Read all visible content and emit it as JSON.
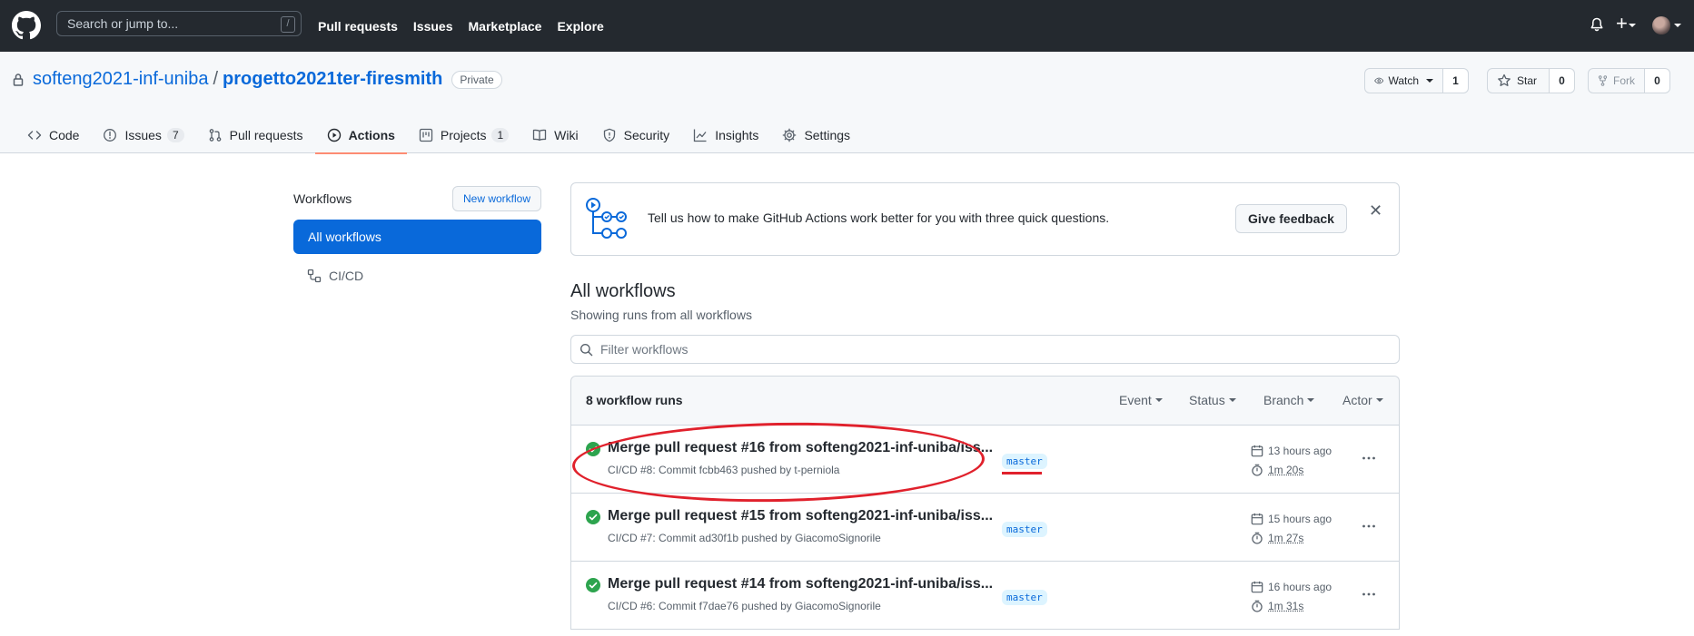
{
  "header": {
    "search_placeholder": "Search or jump to...",
    "search_shortcut": "/",
    "nav": [
      "Pull requests",
      "Issues",
      "Marketplace",
      "Explore"
    ],
    "icons": [
      "github-logo-icon",
      "bell-icon",
      "plus-icon",
      "avatar"
    ]
  },
  "repo": {
    "owner": "softeng2021-inf-uniba",
    "separator": "/",
    "name": "progetto2021ter-firesmith",
    "visibility": "Private",
    "watch_label": "Watch",
    "watch_count": "1",
    "star_label": "Star",
    "star_count": "0",
    "fork_label": "Fork",
    "fork_count": "0"
  },
  "tabs": [
    {
      "label": "Code",
      "icon": "code-icon"
    },
    {
      "label": "Issues",
      "counter": "7",
      "icon": "issue-icon"
    },
    {
      "label": "Pull requests",
      "icon": "pull-request-icon"
    },
    {
      "label": "Actions",
      "icon": "play-icon",
      "active": true
    },
    {
      "label": "Projects",
      "counter": "1",
      "icon": "project-icon"
    },
    {
      "label": "Wiki",
      "icon": "book-icon"
    },
    {
      "label": "Security",
      "icon": "shield-icon"
    },
    {
      "label": "Insights",
      "icon": "graph-icon"
    },
    {
      "label": "Settings",
      "icon": "gear-icon"
    }
  ],
  "sidebar": {
    "title": "Workflows",
    "new_workflow": "New workflow",
    "all_workflows": "All workflows",
    "items": [
      {
        "label": "CI/CD",
        "icon": "workflow-icon"
      }
    ]
  },
  "feedback": {
    "message": "Tell us how to make GitHub Actions work better for you with three quick questions.",
    "button": "Give feedback",
    "close": "✕"
  },
  "main": {
    "title": "All workflows",
    "subtitle": "Showing runs from all workflows",
    "filter_placeholder": "Filter workflows"
  },
  "runs": {
    "count_label": "8 workflow runs",
    "filters": [
      "Event",
      "Status",
      "Branch",
      "Actor"
    ],
    "items": [
      {
        "title": "Merge pull request #16 from softeng2021-inf-uniba/iss...",
        "meta": "CI/CD #8: Commit fcbb463 pushed by t-perniola",
        "branch": "master",
        "time": "13 hours ago",
        "duration": "1m 20s",
        "status": "success"
      },
      {
        "title": "Merge pull request #15 from softeng2021-inf-uniba/iss...",
        "meta": "CI/CD #7: Commit ad30f1b pushed by GiacomoSignorile",
        "branch": "master",
        "time": "15 hours ago",
        "duration": "1m 27s",
        "status": "success"
      },
      {
        "title": "Merge pull request #14 from softeng2021-inf-uniba/iss...",
        "meta": "CI/CD #6: Commit f7dae76 pushed by GiacomoSignorile",
        "branch": "master",
        "time": "16 hours ago",
        "duration": "1m 31s",
        "status": "success"
      }
    ]
  },
  "colors": {
    "accent": "#0969da",
    "success": "#2da44e",
    "annotation": "#e0212c",
    "header_bg": "#24292f"
  }
}
